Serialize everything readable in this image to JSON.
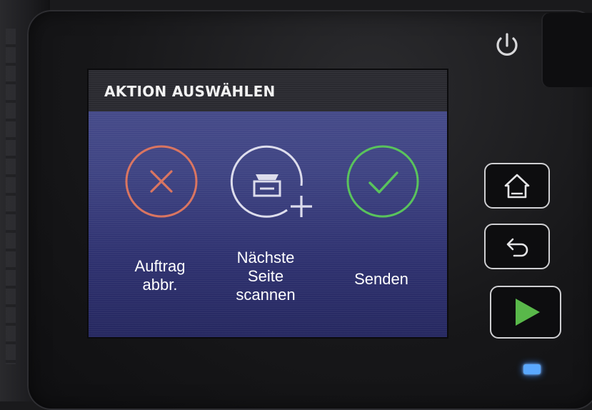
{
  "screen": {
    "title": "AKTION AUSWÄHLEN"
  },
  "actions": [
    {
      "id": "cancel",
      "label_lines": [
        "Auftrag",
        "abbr."
      ],
      "icon": "close-icon",
      "color": "#d9735f"
    },
    {
      "id": "next_page",
      "label_lines": [
        "Nächste",
        "Seite",
        "scannen"
      ],
      "icon": "scan-add-page-icon",
      "color": "#d8d8e8"
    },
    {
      "id": "send",
      "label_lines": [
        "Senden"
      ],
      "icon": "checkmark-icon",
      "color": "#57c25a"
    }
  ],
  "hardware": {
    "power": {
      "icon": "power-icon"
    },
    "home": {
      "icon": "home-icon"
    },
    "back": {
      "icon": "back-icon"
    },
    "start": {
      "icon": "play-icon",
      "color": "#59b84a"
    },
    "status_led": {
      "color": "#5aa8ff"
    }
  }
}
